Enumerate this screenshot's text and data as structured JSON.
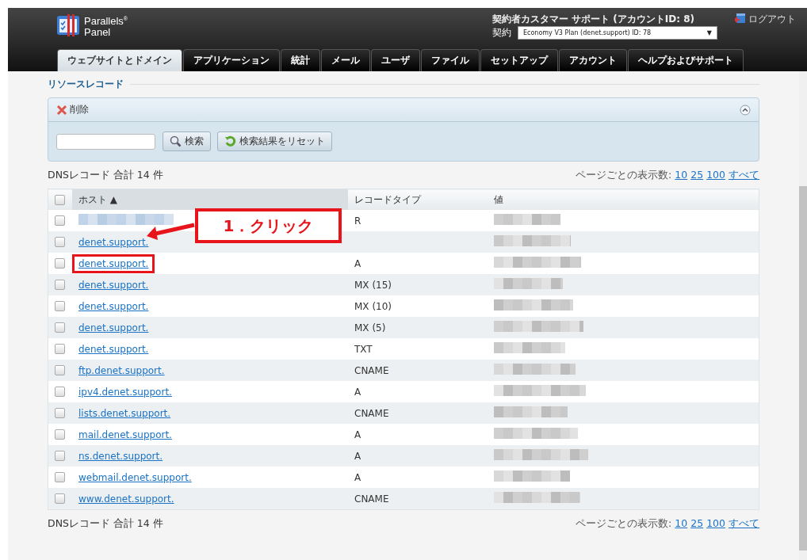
{
  "header": {
    "logo": {
      "line1": "Parallels$^{®}$",
      "line2": "Panel"
    },
    "account": "契約者カスタマー サポート (アカウントID: 8)",
    "subscription_label": "契約",
    "subscription": "Economy V3 Plan (denet.support) ID: 78",
    "subscription_caret": "▼",
    "logout": "ログアウト"
  },
  "tabs": [
    {
      "label": "ウェブサイトとドメイン",
      "selected": true
    },
    {
      "label": "アプリケーション",
      "selected": false
    },
    {
      "label": "統計",
      "selected": false
    },
    {
      "label": "メール",
      "selected": false
    },
    {
      "label": "ユーザ",
      "selected": false
    },
    {
      "label": "ファイル",
      "selected": false
    },
    {
      "label": "セットアップ",
      "selected": false
    },
    {
      "label": "アカウント",
      "selected": false
    },
    {
      "label": "ヘルプおよびサポート",
      "selected": false
    }
  ],
  "section_title": "リソースレコード",
  "toolbar": {
    "delete": "削除",
    "search_button": "検索",
    "reset_button": "検索結果をリセット"
  },
  "summary_top": {
    "count": "DNSレコード 合計 14 件",
    "per_page_label": "ページごとの表示数:",
    "per_page_options": [
      "10",
      "25",
      "100",
      "すべて"
    ]
  },
  "table": {
    "select_all_checked": false,
    "columns": [
      {
        "label": "ホスト",
        "sorted": true,
        "sort_arrow": "▲"
      },
      {
        "label": "レコードタイプ",
        "sorted": false
      },
      {
        "label": "値",
        "sorted": false
      }
    ],
    "rows": [
      {
        "host_blurred": true,
        "type": "R",
        "value_blurred": true,
        "checked": false
      },
      {
        "host": "denet.support.",
        "value_blurred": true,
        "checked": false
      },
      {
        "host": "denet.support.",
        "type": "A",
        "value_blurred": true,
        "highlighted": true,
        "checked": false
      },
      {
        "host": "denet.support.",
        "type": "MX (15)",
        "value_blurred": true,
        "checked": false
      },
      {
        "host": "denet.support.",
        "type": "MX (10)",
        "value_blurred": true,
        "checked": false
      },
      {
        "host": "denet.support.",
        "type": "MX (5)",
        "value_blurred": true,
        "checked": false
      },
      {
        "host": "denet.support.",
        "type": "TXT",
        "value_blurred": true,
        "checked": false
      },
      {
        "host": "ftp.denet.support.",
        "type": "CNAME",
        "value_blurred": true,
        "checked": false
      },
      {
        "host": "ipv4.denet.support.",
        "type": "A",
        "value_blurred": true,
        "checked": false
      },
      {
        "host": "lists.denet.support.",
        "type": "CNAME",
        "value_blurred": true,
        "checked": false
      },
      {
        "host": "mail.denet.support.",
        "type": "A",
        "value_blurred": true,
        "checked": false
      },
      {
        "host": "ns.denet.support.",
        "type": "A",
        "value_blurred": true,
        "checked": false
      },
      {
        "host": "webmail.denet.support.",
        "type": "A",
        "value_blurred": true,
        "checked": false
      },
      {
        "host": "www.denet.support.",
        "type": "CNAME",
        "value_blurred": true,
        "checked": false
      }
    ]
  },
  "callout": "1．クリック",
  "summary_bottom": {
    "count": "DNSレコード 合計 14 件",
    "per_page_label": "ページごとの表示数:",
    "per_page_options": [
      "10",
      "25",
      "100",
      "すべて"
    ]
  }
}
